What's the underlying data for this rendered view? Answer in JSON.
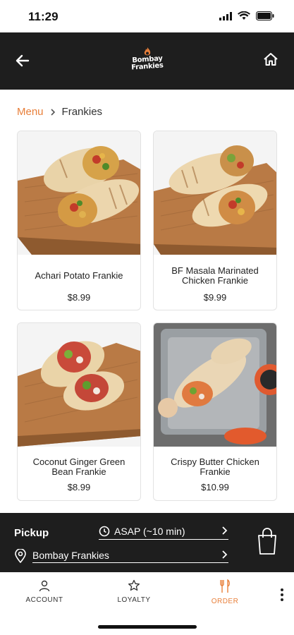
{
  "status_bar": {
    "time": "11:29"
  },
  "header": {
    "brand_line1": "Bombay",
    "brand_line2": "Frankies"
  },
  "breadcrumb": {
    "menu": "Menu",
    "current": "Frankies"
  },
  "items": [
    {
      "name": "Achari Potato Frankie",
      "price": "$8.99"
    },
    {
      "name": "BF Masala Marinated Chicken Frankie",
      "price": "$9.99"
    },
    {
      "name": "Coconut Ginger Green Bean Frankie",
      "price": "$8.99"
    },
    {
      "name": "Crispy Butter Chicken Frankie",
      "price": "$10.99"
    }
  ],
  "pickup": {
    "label": "Pickup",
    "time": "ASAP (~10 min)",
    "location": "Bombay Frankies"
  },
  "tabs": [
    {
      "label": "ACCOUNT",
      "icon": "user-icon"
    },
    {
      "label": "LOYALTY",
      "icon": "star-icon"
    },
    {
      "label": "ORDER",
      "icon": "fork-knife-icon",
      "active": true
    }
  ],
  "colors": {
    "accent": "#e87f3a",
    "dark": "#1e1e1e",
    "card_border": "#e2e2e2"
  }
}
